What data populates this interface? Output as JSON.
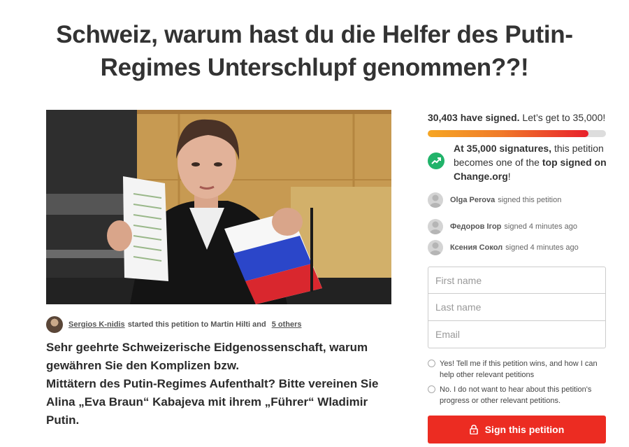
{
  "petition": {
    "title": "Schweiz, warum hast du die Helfer des Putin-Regimes Unterschlupf genommen??!",
    "starter": {
      "author": "Sergios K-nidis",
      "middle_text": "started this petition to Martin Hilti and",
      "others_link": "5 others"
    },
    "body": [
      "Sehr geehrte Schweizerische Eidgenossenschaft, warum gewähren Sie den Komplizen bzw.",
      "Mittätern des Putin-Regimes Aufenthalt? Bitte vereinen Sie Alina „Eva Braun“ Kabajeva mit ihrem „Führer“ Wladimir Putin."
    ]
  },
  "signatures": {
    "count_text": "30,403 have signed.",
    "goal_text": "Let’s get to 35,000!",
    "count": 30403,
    "goal": 35000,
    "progress_fraction": 0.9
  },
  "milestone": {
    "bold1": "At 35,000 signatures,",
    "text1": " this petition becomes one of the ",
    "bold2": "top signed on Change.org",
    "text2": "!"
  },
  "recent_signers": [
    {
      "name": "Olga Perova",
      "action": "signed this petition"
    },
    {
      "name": "Федоров Ігор",
      "action": "signed 4 minutes ago"
    },
    {
      "name": "Ксения Сокол",
      "action": "signed 4 minutes ago"
    }
  ],
  "form": {
    "first_name_placeholder": "First name",
    "last_name_placeholder": "Last name",
    "email_placeholder": "Email",
    "opt_in_yes": "Yes! Tell me if this petition wins, and how I can help other relevant petitions",
    "opt_in_no": "No. I do not want to hear about this petition's progress or other relevant petitions.",
    "sign_button": "Sign this petition"
  },
  "colors": {
    "accent": "#ec2c22",
    "success": "#21b36a",
    "progress_start": "#f6a623",
    "progress_end": "#e8202a"
  }
}
